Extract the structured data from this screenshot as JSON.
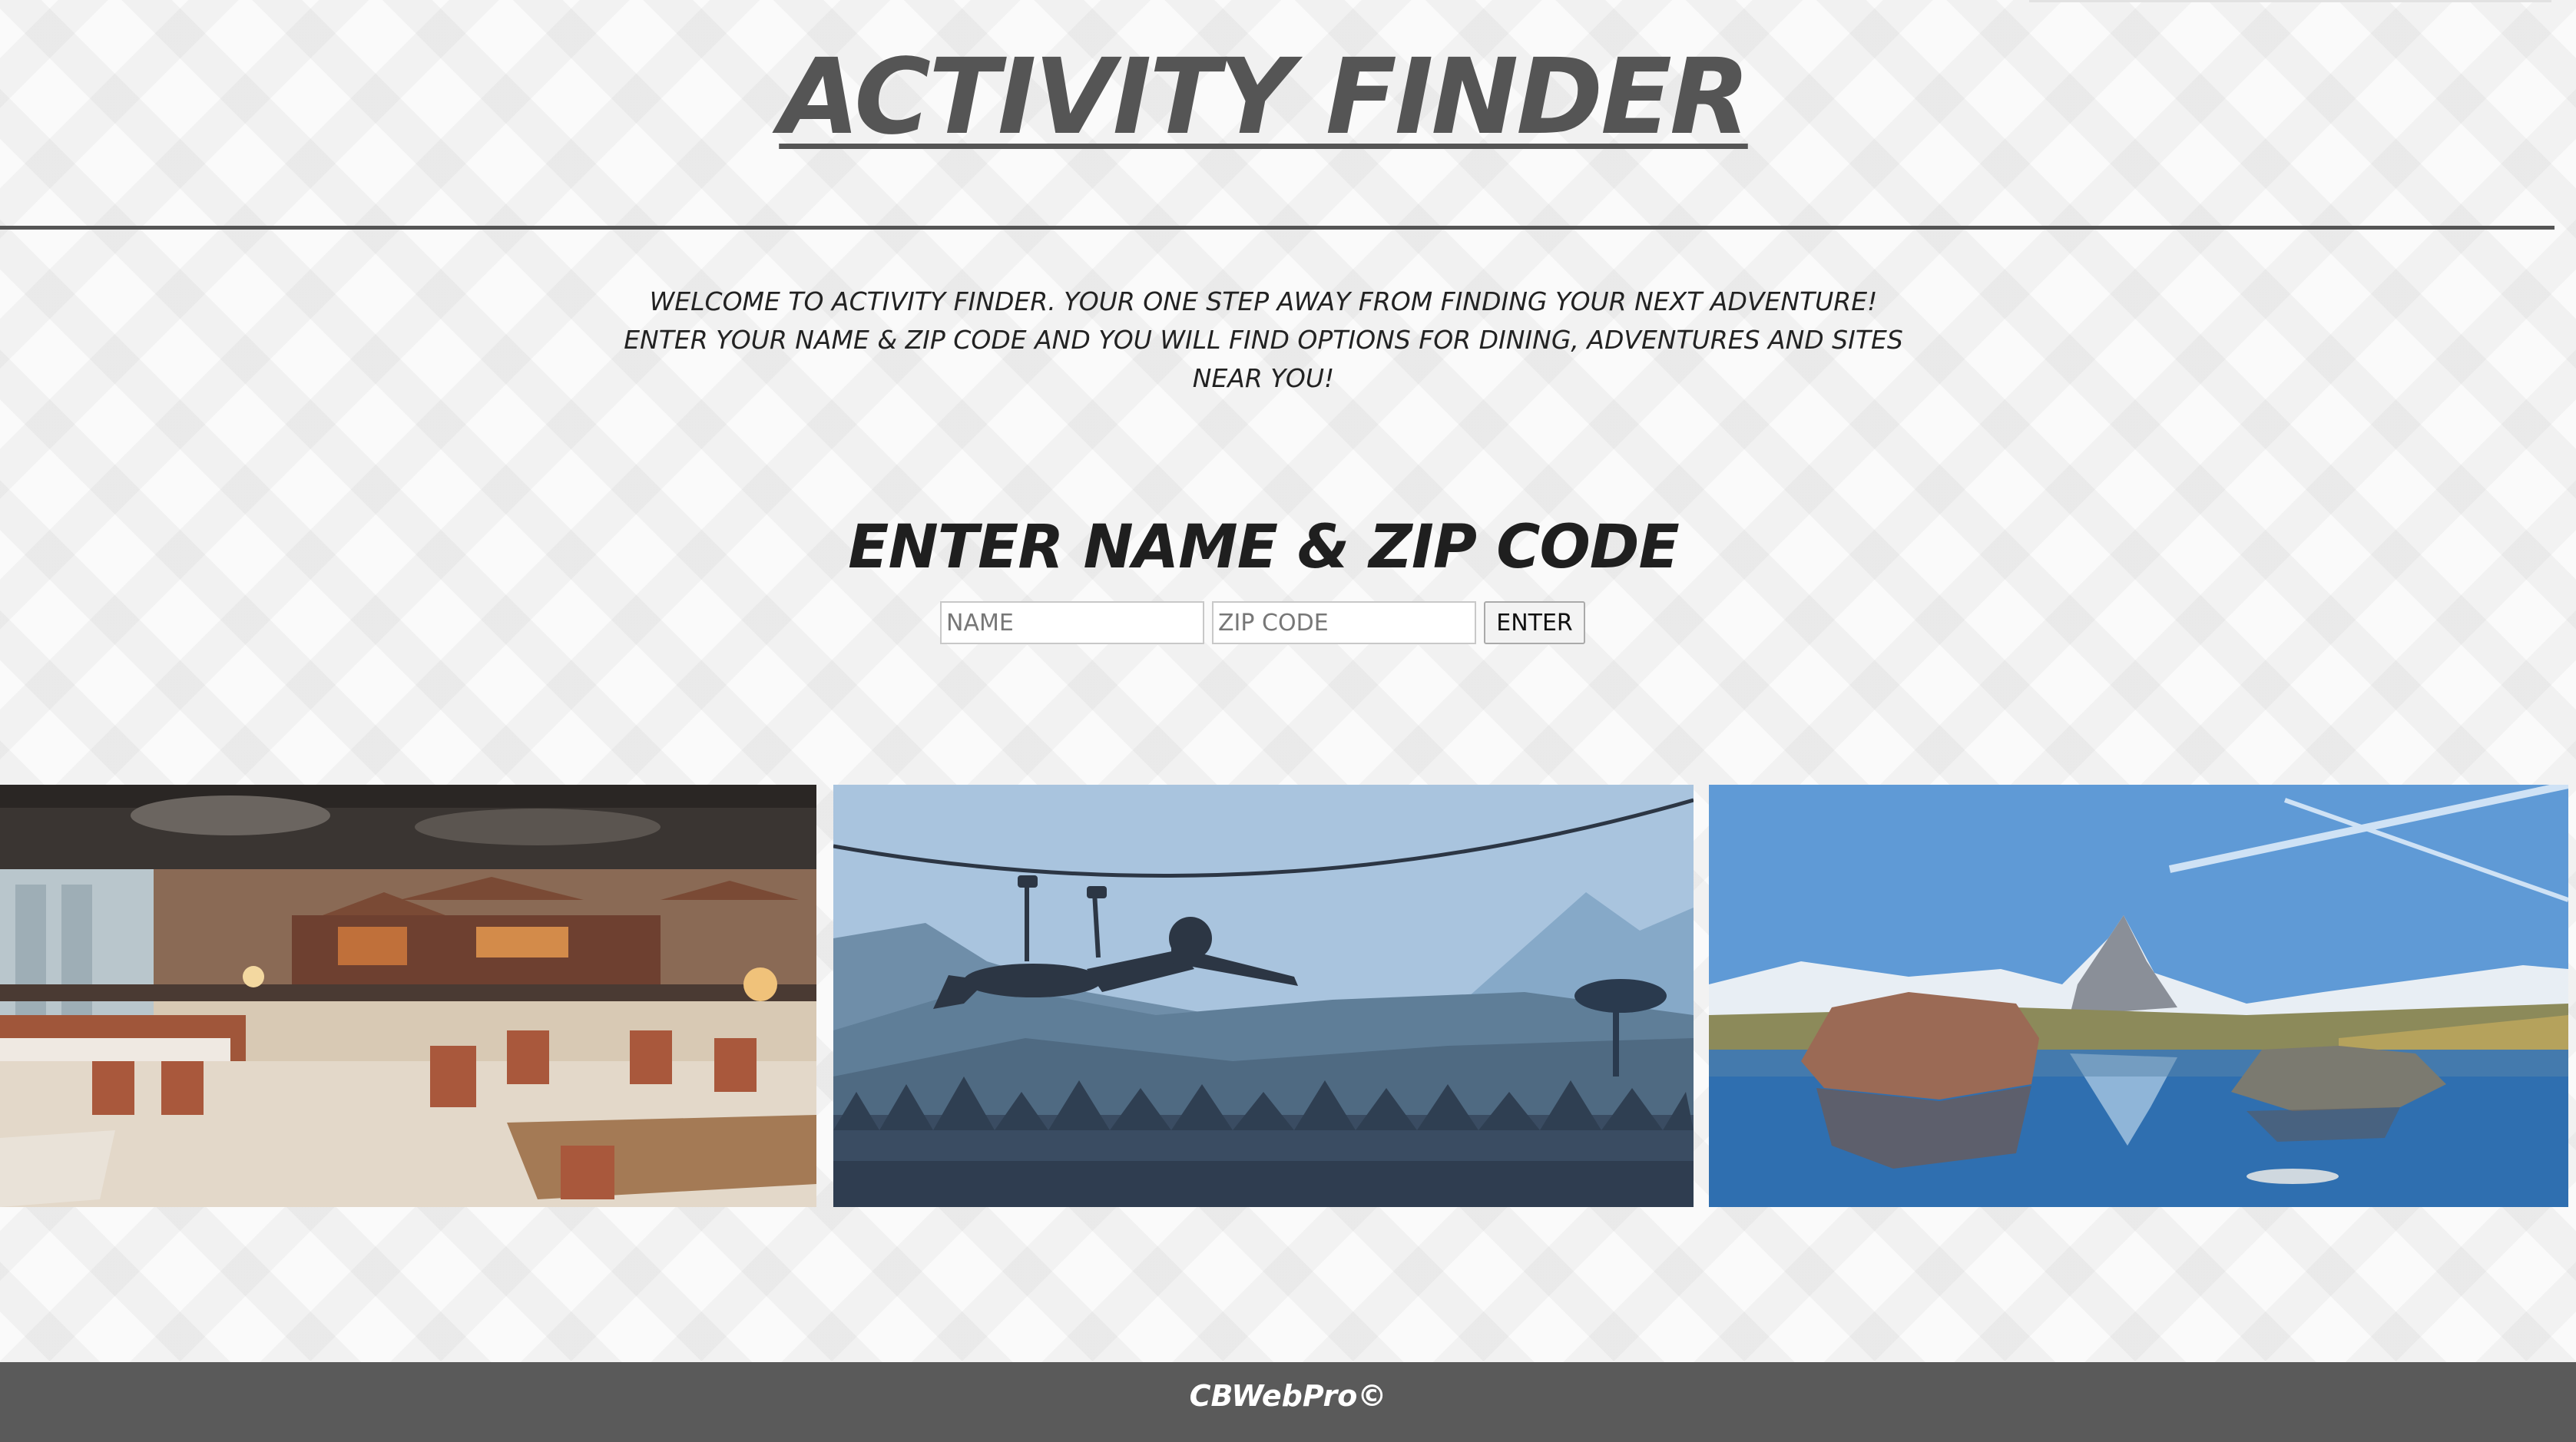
{
  "header": {
    "title": "ACTIVITY FINDER"
  },
  "intro": {
    "text": "WELCOME TO ACTIVITY FINDER. YOUR ONE STEP AWAY FROM FINDING YOUR NEXT ADVENTURE! ENTER YOUR NAME & ZIP CODE AND YOU WILL FIND OPTIONS FOR DINING, ADVENTURES AND SITES NEAR YOU!"
  },
  "form": {
    "title": "ENTER NAME & ZIP CODE",
    "name_placeholder": "NAME",
    "zip_placeholder": "ZIP CODE",
    "enter_label": "ENTER"
  },
  "gallery": {
    "images": [
      {
        "name": "dining-photo",
        "subject": "restaurant interior"
      },
      {
        "name": "adventure-photo",
        "subject": "zip-line silhouette over mountains"
      },
      {
        "name": "sites-photo",
        "subject": "mountain lake with reflection"
      }
    ]
  },
  "footer": {
    "text": "CBWebPro©"
  },
  "colors": {
    "header_text": "#555555",
    "footer_bg": "#5a5a5a",
    "footer_text": "#ffffff"
  }
}
